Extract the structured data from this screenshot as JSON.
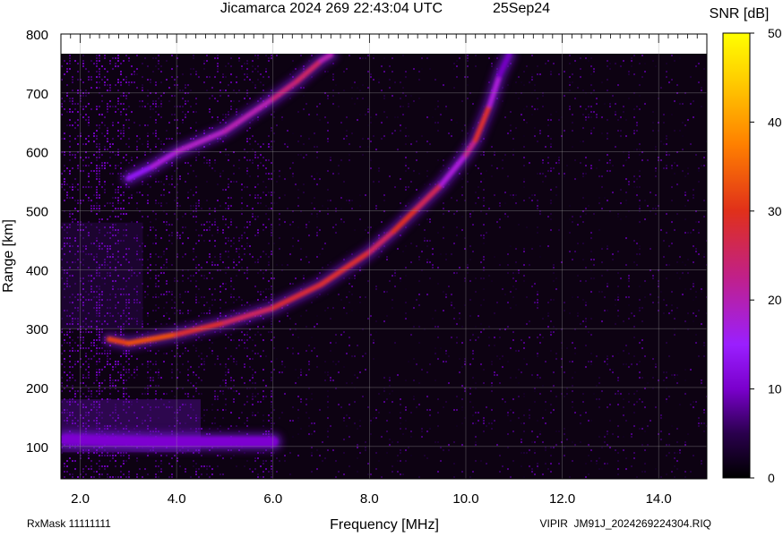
{
  "header": {
    "title": "Jicamarca 2024 269 22:43:04 UTC",
    "date": "25Sep24",
    "colorbar_label": "SNR [dB]"
  },
  "footer": {
    "rxmask": "RxMask 11111111",
    "filename": "VIPIR  JM91J_2024269224304.RIQ"
  },
  "chart_data": {
    "type": "heatmap",
    "title": "Jicamarca 2024 269 22:43:04 UTC",
    "xlabel": "Frequency [MHz]",
    "ylabel": "Range [km]",
    "xlim": [
      1.6,
      15.0
    ],
    "ylim": [
      45,
      800
    ],
    "data_ceiling_km": 765,
    "xticks": [
      2,
      4,
      6,
      8,
      10,
      12,
      14
    ],
    "xtick_labels": [
      "2.0",
      "4.0",
      "6.0",
      "8.0",
      "10.0",
      "12.0",
      "14.0"
    ],
    "yticks": [
      100,
      200,
      300,
      400,
      500,
      600,
      700,
      800
    ],
    "ytick_labels": [
      "100",
      "200",
      "300",
      "400",
      "500",
      "600",
      "700",
      "800"
    ],
    "colorbar": {
      "label": "SNR [dB]",
      "range": [
        0,
        50
      ],
      "ticks": [
        0,
        10,
        20,
        30,
        40,
        50
      ],
      "tick_labels": [
        "0",
        "10",
        "20",
        "30",
        "40",
        "50"
      ],
      "colormap": [
        "#000000",
        "#2a004d",
        "#7a00cc",
        "#9a1fff",
        "#c0208a",
        "#e0301a",
        "#ff8000",
        "#ffd000",
        "#ffff00"
      ]
    },
    "traces": [
      {
        "name": "E-layer band",
        "points": [
          [
            1.7,
            112
          ],
          [
            2.5,
            110
          ],
          [
            3.5,
            108
          ],
          [
            4.5,
            108
          ],
          [
            6.0,
            108
          ]
        ],
        "snr": 13
      },
      {
        "name": "F-layer first-hop O trace",
        "points": [
          [
            2.6,
            282
          ],
          [
            3.0,
            275
          ],
          [
            4.0,
            290
          ],
          [
            5.0,
            310
          ],
          [
            6.0,
            335
          ],
          [
            7.0,
            375
          ],
          [
            8.0,
            430
          ],
          [
            8.5,
            465
          ],
          [
            9.0,
            505
          ],
          [
            9.5,
            545
          ],
          [
            10.0,
            595
          ],
          [
            10.2,
            620
          ],
          [
            10.5,
            680
          ],
          [
            10.7,
            730
          ],
          [
            10.9,
            765
          ]
        ],
        "snr_along": [
          30,
          35,
          32,
          28,
          27,
          32,
          28,
          27,
          34,
          22,
          20,
          30,
          30,
          12,
          12
        ]
      },
      {
        "name": "Multihop trace",
        "points": [
          [
            3.0,
            555
          ],
          [
            3.5,
            575
          ],
          [
            4.0,
            600
          ],
          [
            5.0,
            635
          ],
          [
            6.0,
            690
          ],
          [
            6.5,
            720
          ],
          [
            7.0,
            755
          ],
          [
            7.2,
            765
          ]
        ],
        "snr_along": [
          14,
          20,
          22,
          22,
          24,
          28,
          26,
          20
        ]
      }
    ]
  }
}
